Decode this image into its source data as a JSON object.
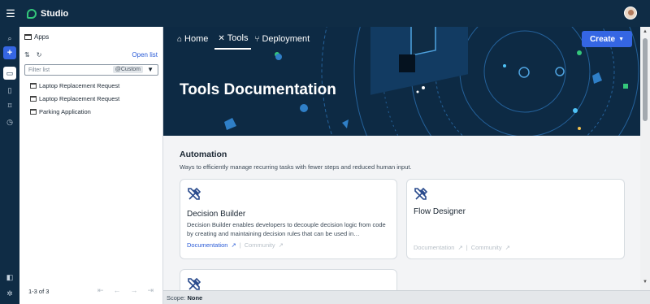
{
  "app": {
    "name": "Studio"
  },
  "apps_panel": {
    "title": "Apps",
    "open_list": "Open list",
    "filter_placeholder": "Filter list",
    "filter_chip": "@Custom",
    "items": [
      {
        "label": "Laptop Replacement Request"
      },
      {
        "label": "Laptop Replacement Request"
      },
      {
        "label": "Parking Application"
      }
    ],
    "pager_text": "1-3 of 3"
  },
  "nav": {
    "tabs": [
      {
        "label": "Home",
        "icon": "home-icon"
      },
      {
        "label": "Tools",
        "icon": "tools-icon"
      },
      {
        "label": "Deployment",
        "icon": "branch-icon"
      }
    ],
    "active": "Tools",
    "create_label": "Create"
  },
  "hero": {
    "title": "Tools Documentation"
  },
  "section": {
    "title": "Automation",
    "description": "Ways to efficiently manage recurring tasks with fewer steps and reduced human input."
  },
  "cards": [
    {
      "title": "Decision Builder",
      "text": "Decision Builder enables developers to decouple decision logic from code by creating and maintaining decision rules that can be used in…",
      "doc_link": "Documentation",
      "community_link": "Community"
    },
    {
      "title": "Flow Designer",
      "text": "",
      "doc_link": "Documentation",
      "community_link": "Community"
    }
  ],
  "scope": {
    "label": "Scope:",
    "value": "None"
  },
  "colors": {
    "accent": "#3566e3",
    "nav_bg": "#0f2c45",
    "hero_bg": "#0d2a44",
    "link": "#2a5bd7",
    "brand_green": "#34c77b"
  }
}
